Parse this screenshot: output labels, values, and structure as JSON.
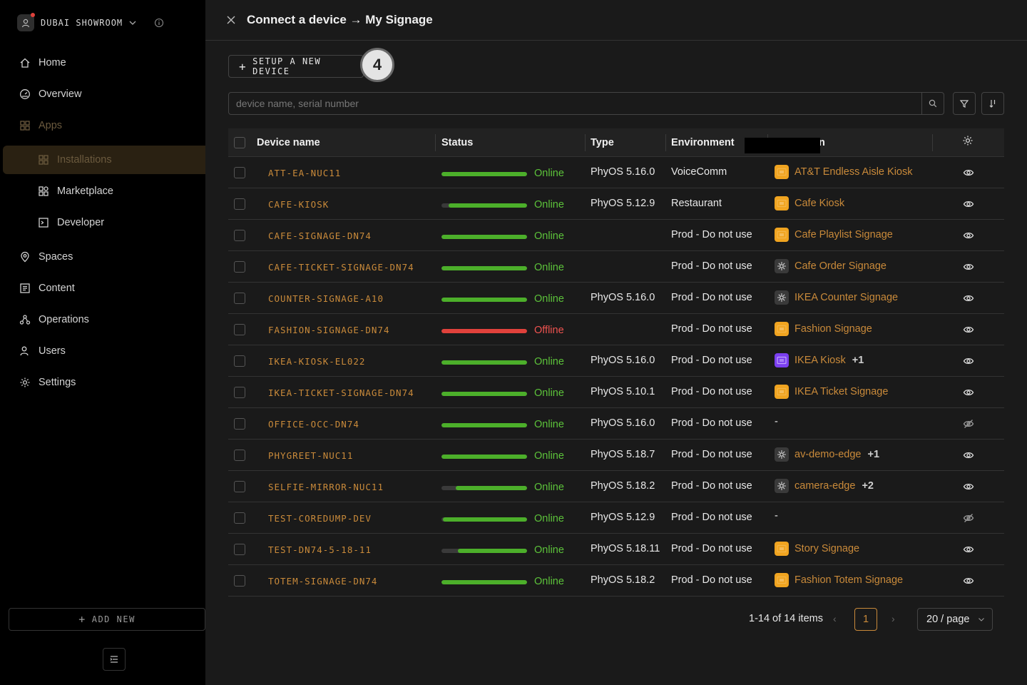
{
  "sidebar": {
    "org_name": "DUBAI SHOWROOM",
    "nav": [
      {
        "label": "Home",
        "icon": "home-icon"
      },
      {
        "label": "Overview",
        "icon": "dashboard-icon"
      },
      {
        "label": "Apps",
        "icon": "apps-grid-icon"
      },
      {
        "label": "Installations",
        "icon": "apps-grid-icon"
      },
      {
        "label": "Marketplace",
        "icon": "marketplace-icon"
      },
      {
        "label": "Developer",
        "icon": "terminal-icon"
      },
      {
        "label": "Spaces",
        "icon": "location-pin-icon"
      },
      {
        "label": "Content",
        "icon": "content-icon"
      },
      {
        "label": "Operations",
        "icon": "operations-icon"
      },
      {
        "label": "Users",
        "icon": "users-icon"
      },
      {
        "label": "Settings",
        "icon": "gear-icon"
      }
    ],
    "add_new_label": "ADD NEW"
  },
  "header": {
    "title": "Connect a device → My Signage"
  },
  "toolbar": {
    "setup_label": "SETUP A NEW DEVICE",
    "step_badge": "4",
    "search_placeholder": "device name, serial number"
  },
  "table": {
    "columns": [
      "Device name",
      "Status",
      "Type",
      "Environment",
      "n"
    ],
    "rows": [
      {
        "name": "ATT-EA-NUC11",
        "status": "Online",
        "health": 1.0,
        "type": "PhyOS 5.16.0",
        "env": "VoiceComm",
        "app": "AT&T Endless Aisle Kiosk",
        "app_icon": "orange",
        "more": "",
        "visible": true
      },
      {
        "name": "CAFE-KIOSK",
        "status": "Online",
        "health": 0.92,
        "type": "PhyOS 5.12.9",
        "env": "Restaurant",
        "app": "Cafe Kiosk",
        "app_icon": "orange",
        "more": "",
        "visible": true
      },
      {
        "name": "CAFE-SIGNAGE-DN74",
        "status": "Online",
        "health": 1.0,
        "type": "",
        "env": "Prod - Do not use",
        "app": "Cafe Playlist Signage",
        "app_icon": "orange",
        "more": "",
        "visible": true
      },
      {
        "name": "CAFE-TICKET-SIGNAGE-DN74",
        "status": "Online",
        "health": 1.0,
        "type": "",
        "env": "Prod - Do not use",
        "app": "Cafe Order Signage",
        "app_icon": "gray",
        "more": "",
        "visible": true
      },
      {
        "name": "COUNTER-SIGNAGE-A10",
        "status": "Online",
        "health": 1.0,
        "type": "PhyOS 5.16.0",
        "env": "Prod - Do not use",
        "app": "IKEA Counter Signage",
        "app_icon": "gray",
        "more": "",
        "visible": true
      },
      {
        "name": "FASHION-SIGNAGE-DN74",
        "status": "Offline",
        "health": 1.0,
        "type": "",
        "env": "Prod - Do not use",
        "app": "Fashion Signage",
        "app_icon": "orange",
        "more": "",
        "visible": true
      },
      {
        "name": "IKEA-KIOSK-EL022",
        "status": "Online",
        "health": 1.0,
        "type": "PhyOS 5.16.0",
        "env": "Prod - Do not use",
        "app": "IKEA Kiosk",
        "app_icon": "purple",
        "more": "+1",
        "visible": true
      },
      {
        "name": "IKEA-TICKET-SIGNAGE-DN74",
        "status": "Online",
        "health": 1.0,
        "type": "PhyOS 5.10.1",
        "env": "Prod - Do not use",
        "app": "IKEA Ticket Signage",
        "app_icon": "orange",
        "more": "",
        "visible": true
      },
      {
        "name": "OFFICE-OCC-DN74",
        "status": "Online",
        "health": 1.0,
        "type": "PhyOS 5.16.0",
        "env": "Prod - Do not use",
        "app": "-",
        "app_icon": "",
        "more": "",
        "visible": false
      },
      {
        "name": "PHYGREET-NUC11",
        "status": "Online",
        "health": 1.0,
        "type": "PhyOS 5.18.7",
        "env": "Prod - Do not use",
        "app": "av-demo-edge",
        "app_icon": "gray",
        "more": "+1",
        "visible": true
      },
      {
        "name": "SELFIE-MIRROR-NUC11",
        "status": "Online",
        "health": 0.83,
        "type": "PhyOS 5.18.2",
        "env": "Prod - Do not use",
        "app": "camera-edge",
        "app_icon": "gray",
        "more": "+2",
        "visible": true
      },
      {
        "name": "TEST-COREDUMP-DEV",
        "status": "Online",
        "health": 0.98,
        "type": "PhyOS 5.12.9",
        "env": "Prod - Do not use",
        "app": "-",
        "app_icon": "",
        "more": "",
        "visible": false
      },
      {
        "name": "TEST-DN74-5-18-11",
        "status": "Online",
        "health": 0.81,
        "type": "PhyOS 5.18.11",
        "env": "Prod - Do not use",
        "app": "Story Signage",
        "app_icon": "orange",
        "more": "",
        "visible": true
      },
      {
        "name": "TOTEM-SIGNAGE-DN74",
        "status": "Online",
        "health": 1.0,
        "type": "PhyOS 5.18.2",
        "env": "Prod - Do not use",
        "app": "Fashion Totem Signage",
        "app_icon": "orange",
        "more": "",
        "visible": true
      }
    ]
  },
  "pagination": {
    "total": "1-14 of 14 items",
    "page": "1",
    "page_size": "20 / page"
  },
  "colors": {
    "accent": "#c98a3a",
    "online": "#4caf2a",
    "offline": "#e0413b",
    "online_text": "#5cc23a",
    "offline_text": "#ef5350"
  }
}
